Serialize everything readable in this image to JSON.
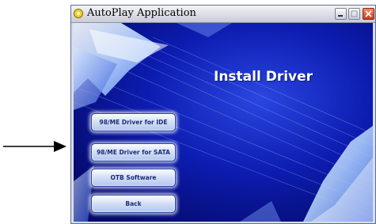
{
  "window": {
    "title": "AutoPlay Application",
    "controls": {
      "minimize": "minimize",
      "maximize": "maximize",
      "close": "close"
    }
  },
  "main": {
    "heading": "Install Driver",
    "buttons": [
      {
        "label": "98/ME Driver for IDE"
      },
      {
        "label": "98/ME Driver for SATA"
      },
      {
        "label": "OTB Software"
      },
      {
        "label": "Back"
      }
    ]
  },
  "colors": {
    "background_blue": "#0a1aa8",
    "button_text": "#1a2e78",
    "title_bar": "#dcdde5"
  },
  "icons": [
    "autoplay-app-icon",
    "minimize-icon",
    "maximize-icon",
    "close-icon",
    "pointer-arrow-icon"
  ]
}
